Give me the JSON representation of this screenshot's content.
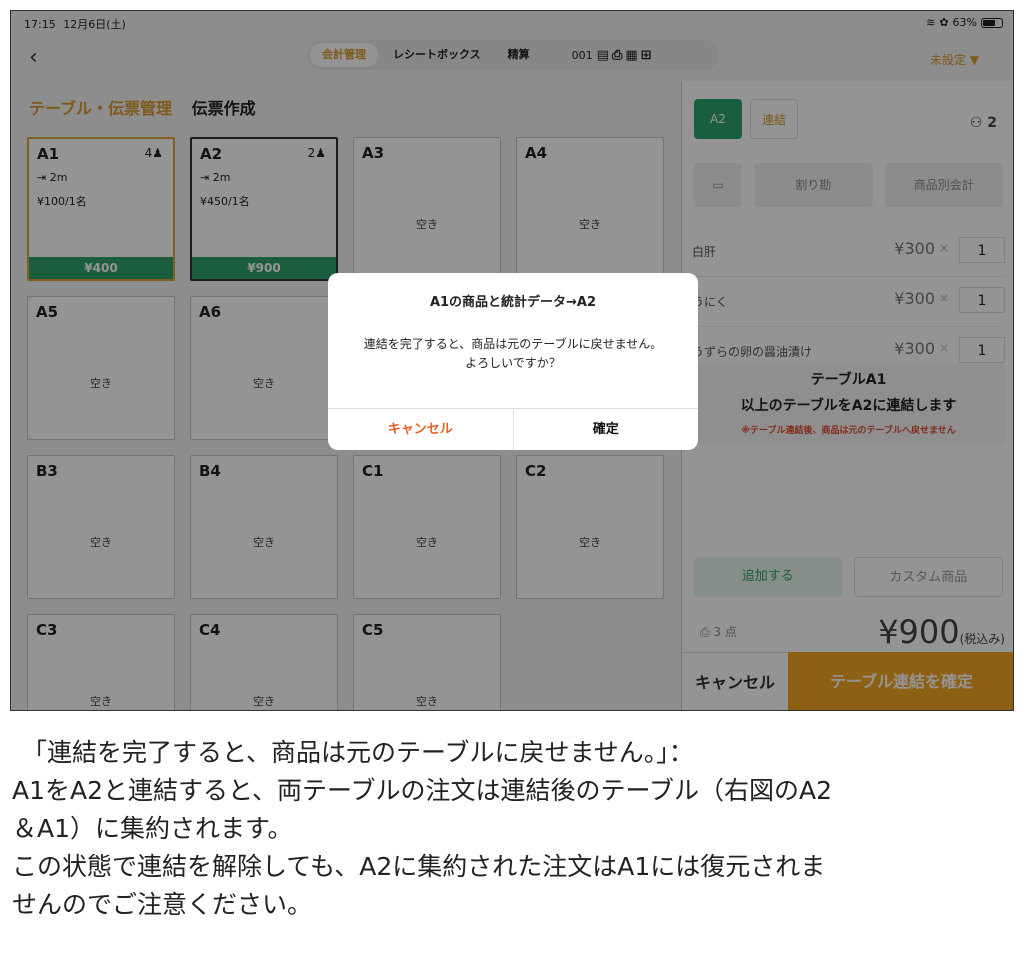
{
  "status_bar": {
    "time": "17:15",
    "date": "12月6日(土)",
    "battery": "63%"
  },
  "top": {
    "back_icon": "chevron-left-icon",
    "segments": [
      "会計管理",
      "レシートボックス",
      "精算"
    ],
    "segment_id": "001",
    "unset": "未設定 ▼"
  },
  "page": {
    "section_a": "テーブル・伝票管理",
    "section_b": "伝票作成"
  },
  "tables": [
    {
      "name": "A1",
      "guests": "4",
      "line1": "2m",
      "line2": "¥100/1名",
      "total": "¥400",
      "status": ""
    },
    {
      "name": "A2",
      "guests": "2",
      "line1": "2m",
      "line2": "¥450/1名",
      "total": "¥900",
      "status": ""
    },
    {
      "name": "A3",
      "status": "空き"
    },
    {
      "name": "A4",
      "status": "空き"
    },
    {
      "name": "A5",
      "status": "空き"
    },
    {
      "name": "A6",
      "status": "空き"
    },
    {
      "name": "B3",
      "status": "空き"
    },
    {
      "name": "B4",
      "status": "空き"
    },
    {
      "name": "C1",
      "status": "空き"
    },
    {
      "name": "C2",
      "status": "空き"
    },
    {
      "name": "C3",
      "status": "空き"
    },
    {
      "name": "C4",
      "status": "空き"
    },
    {
      "name": "C5",
      "status": "空き"
    }
  ],
  "right": {
    "tab_a": "A2",
    "tab_b": "連結",
    "persons": "2",
    "actions": [
      "",
      "割り勘",
      "商品別会計"
    ],
    "items": [
      {
        "name": "白肝",
        "price": "¥300",
        "x": "×",
        "qty": "1"
      },
      {
        "name": "うにく",
        "price": "¥300",
        "x": "×",
        "qty": "1"
      },
      {
        "name": "うずらの卵の醤油漬け",
        "price": "¥300",
        "x": "×",
        "qty": "1"
      }
    ],
    "confirm_l1": "テーブルA1",
    "confirm_l2": "以上のテーブルをA2に連結します",
    "confirm_l3": "※テーブル連結後、商品は元のテーブルへ戻せません",
    "add_label": "追加する",
    "custom_label": "カスタム商品",
    "count": "3 点",
    "price": "¥900",
    "tax": "(税込み)",
    "cancel": "キャンセル",
    "confirm_button": "テーブル連結を確定"
  },
  "dialog": {
    "title": "A1の商品と統計データ→A2",
    "message_1": "連結を完了すると、商品は元のテーブルに戻せません。",
    "message_2": "よろしいですか？",
    "cancel": "キャンセル",
    "ok": "確定"
  },
  "caption": {
    "line1": "「連結を完了すると、商品は元のテーブルに戻せません。」：",
    "line2": "A1をA2と連結すると、両テーブルの注文は連結後のテーブル（右図のA2",
    "line3": "＆A1）に集約されます。",
    "line4": "この状態で連結を解除しても、A2に集約された注文はA1には復元されま",
    "line5": "せんのでご注意ください。"
  }
}
